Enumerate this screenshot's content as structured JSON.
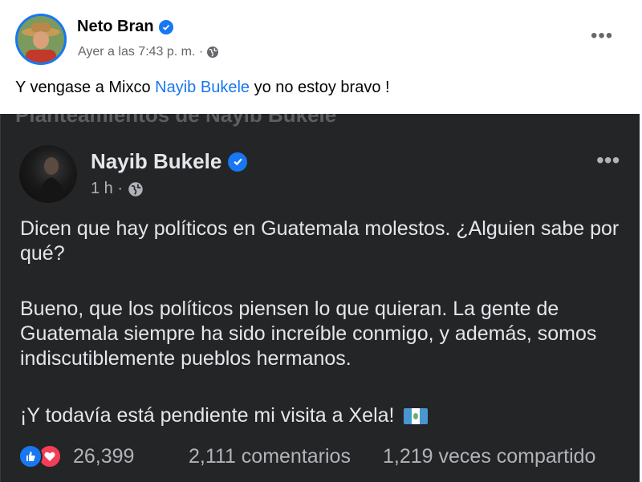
{
  "post": {
    "author": "Neto Bran",
    "meta": "Ayer a las 7:43 p. m. ·",
    "text_before": "Y vengase a Mixco ",
    "mention": "Nayib Bukele",
    "text_after": " yo no estoy bravo !",
    "more": "•••"
  },
  "shared": {
    "author": "Nayib Bukele",
    "meta": "1 h ·",
    "more": "•••",
    "paragraph1": "Dicen que hay políticos en Guatemala molestos. ¿Alguien sabe por qué?",
    "paragraph2": "Bueno, que los políticos piensen lo que quieran. La gente de Guatemala siempre ha sido increíble conmigo, y además, somos indiscutiblemente pueblos hermanos.",
    "paragraph3": "¡Y todavía está pendiente mi visita a Xela!",
    "reactions_count": "26,399",
    "comments": "2,111 comentarios",
    "shares": "1,219 veces compartido"
  },
  "colors": {
    "accent": "#1877f2",
    "dark_bg": "#242526",
    "love": "#f33e58"
  },
  "icons": [
    "verified-badge-icon",
    "globe-icon",
    "more-options-icon",
    "like-reaction-icon",
    "love-reaction-icon",
    "guatemala-flag-icon"
  ]
}
